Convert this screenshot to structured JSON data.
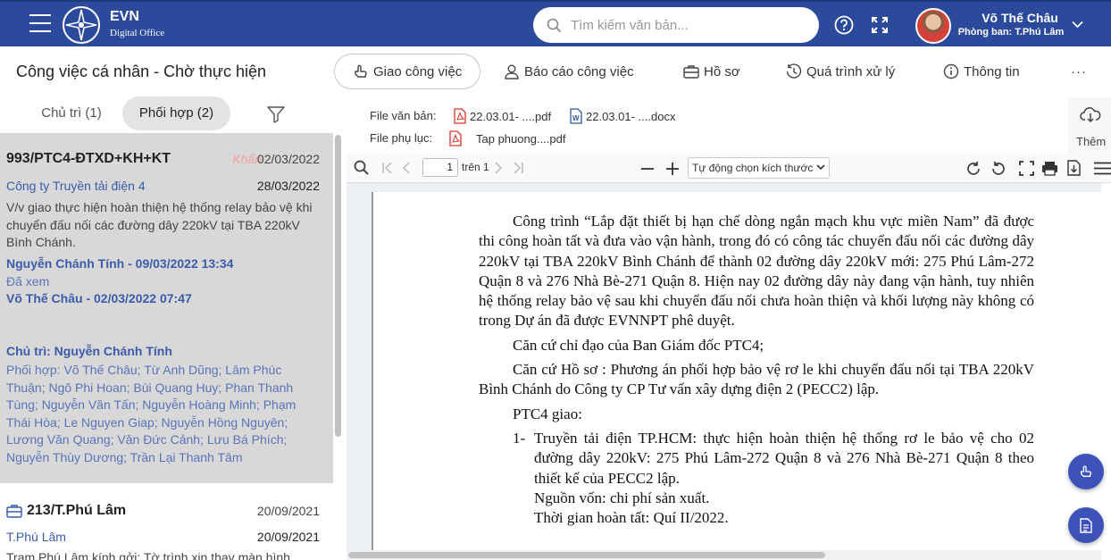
{
  "app": {
    "brand": "EVN",
    "brand_sub": "Digital Office"
  },
  "header": {
    "search_placeholder": "Tìm kiếm văn bản...",
    "user_name": "Võ Thế Châu",
    "user_dept": "Phòng ban: T.Phú Lâm"
  },
  "toolbar": {
    "title": "Công việc cá nhân - Chờ thực hiện",
    "actions": [
      "Giao công việc",
      "Báo cáo công việc",
      "Hồ sơ",
      "Quá trình xử lý",
      "Thông tin"
    ],
    "more": "···"
  },
  "tabs": {
    "chutri": "Chủ trì (1)",
    "phoihop": "Phối hợp (2)"
  },
  "list": [
    {
      "code": "993/PTC4-ĐTXD+KH+KT",
      "urgent": "Khẩn",
      "date": "02/03/2022",
      "org": "Công ty Truyền tải điện 4",
      "date2": "28/03/2022",
      "desc": "V/v giao thực hiện hoàn thiện hệ thống relay bảo vệ khi chuyển đấu nối các đường dây 220kV tại TBA 220kV Bình Chánh.",
      "person1": "Nguyễn Chánh Tính - 09/03/2022 13:34",
      "status": "Đã xem",
      "person2": "Võ Thế Châu - 02/03/2022 07:47",
      "chutri": "Chủ trì: Nguyễn Chánh Tính",
      "phoihop": "Phối hợp: Võ Thế Châu; Từ Anh Dũng; Lâm Phúc Thuận; Ngô Phi Hoan; Bùi Quang Huy; Phan Thanh Tùng; Nguyễn Văn Tấn; Nguyễn Hoàng Minh; Phạm Thái Hòa; Le Nguyen Giap; Nguyễn Hồng Nguyên; Lương Văn Quang; Văn Đức Cảnh; Lưu Bá Phích; Nguyễn Thùy Dương; Trần Lại Thanh Tâm"
    },
    {
      "code": "213/T.Phú Lâm",
      "date": "20/09/2021",
      "org": "T.Phú Lâm",
      "date2": "20/09/2021",
      "desc": "Trạm Phú Lâm kính gởi: Tờ trình xin thay màn hình"
    }
  ],
  "files": {
    "label_vanban": "File văn bản:",
    "label_phuluc": "File phụ lục:",
    "vanban_pdf": "22.03.01- ....pdf",
    "vanban_docx": "22.03.01- ....docx",
    "phuluc_pdf": "Tap phuong....pdf",
    "more": "Thêm"
  },
  "pdf": {
    "page": "1",
    "total": "trên 1",
    "zoom": "Tự động chọn kích thước",
    "paragraphs": [
      "Công trình “Lắp đặt thiết bị hạn chế dòng ngắn mạch khu vực miền Nam” đã được thi công hoàn tất và đưa vào vận hành, trong đó có công tác chuyển đấu nối các đường dây 220kV tại TBA 220kV Bình Chánh để thành 02 đường dây 220kV mới: 275 Phú Lâm-272 Quận 8 và 276 Nhà Bè-271 Quận 8. Hiện nay 02 đường dây này đang vận hành, tuy nhiên hệ thống relay bảo vệ sau khi chuyển đấu nối chưa hoàn thiện và khối lượng này không có trong Dự án đã được EVNNPT phê duyệt.",
      "Căn cứ chỉ đạo của Ban Giám đốc PTC4;",
      "Căn cứ Hồ sơ : Phương án phối hợp bảo vệ rơ le khi chuyển đấu nối tại TBA 220kV Bình Chánh do Công ty CP Tư vấn xây dựng điện 2 (PECC2) lập.",
      "PTC4 giao:"
    ],
    "item_num": "1-",
    "item_text": "Truyền tải điện TP.HCM: thực hiện hoàn thiện hệ thống rơ le bảo vệ cho 02 đường dây 220kV: 275 Phú Lâm-272 Quận 8 và 276 Nhà Bè-271 Quận 8 theo thiết kế của PECC2 lập.",
    "sub1": "Nguồn vốn: chi phí sản xuất.",
    "sub2": "Thời gian hoàn tất: Quí II/2022."
  },
  "colors": {
    "header": "#2b4a9b",
    "accent": "#3d52b8",
    "link": "#3c5bab"
  }
}
